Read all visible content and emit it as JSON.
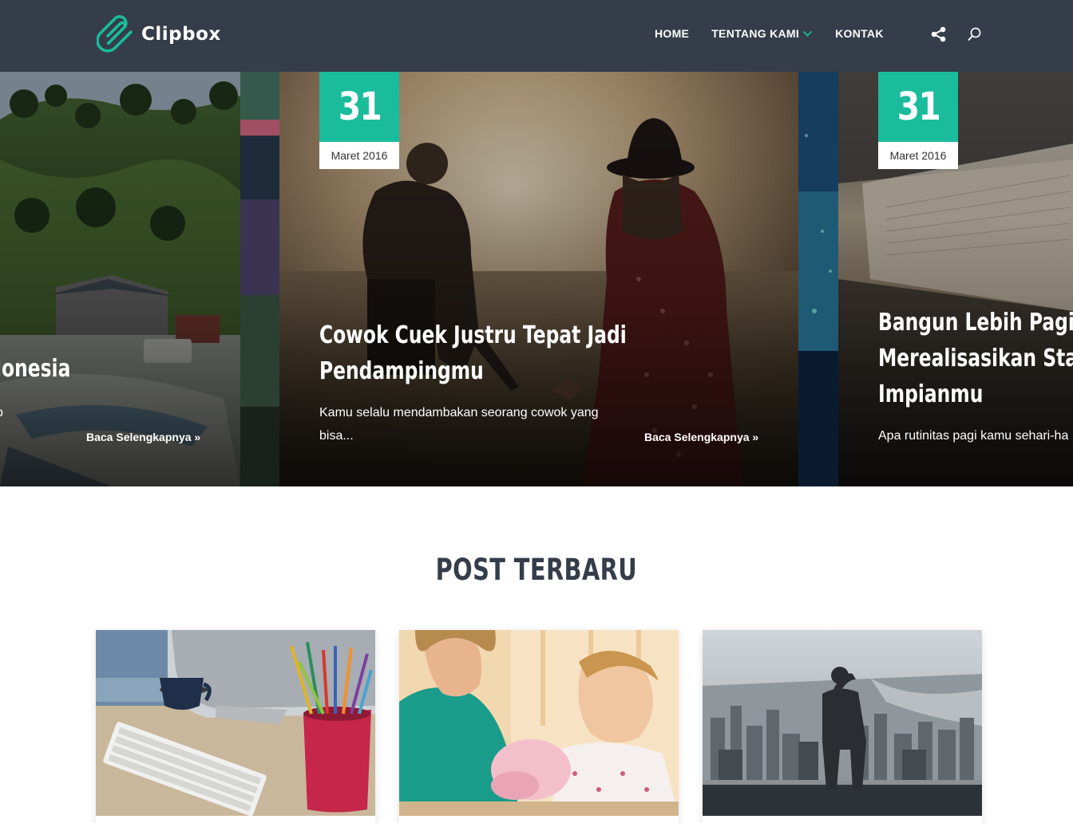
{
  "brand": {
    "name": "Clipbox",
    "accent": "#1abc9c",
    "header_bg": "#343d49"
  },
  "nav": {
    "items": [
      {
        "label": "HOME"
      },
      {
        "label": "TENTANG KAMI",
        "has_dropdown": true
      },
      {
        "label": "KONTAK"
      }
    ],
    "icons": [
      "share-icon",
      "search-icon"
    ]
  },
  "slider": {
    "slides": [
      {
        "title_fragment": "lonesia",
        "excerpt_fragment": "p",
        "read_more": "Baca Selengkapnya"
      },
      {
        "day": "31",
        "month": "Maret 2016",
        "title_line1": "Cowok Cuek Justru Tepat Jadi",
        "title_line2": "Pendampingmu",
        "excerpt_line1": "Kamu selalu mendambakan seorang cowok yang",
        "excerpt_line2": "bisa...",
        "read_more": "Baca Selengkapnya"
      },
      {
        "day": "31",
        "month": "Maret 2016",
        "title_line1": "Bangun Lebih Pagi ag",
        "title_line2": "Merealisasikan Startu",
        "title_line3": "Impianmu",
        "excerpt_line1": "Apa rutinitas pagi kamu sehari-ha"
      }
    ]
  },
  "section": {
    "title": "POST TERBARU"
  }
}
